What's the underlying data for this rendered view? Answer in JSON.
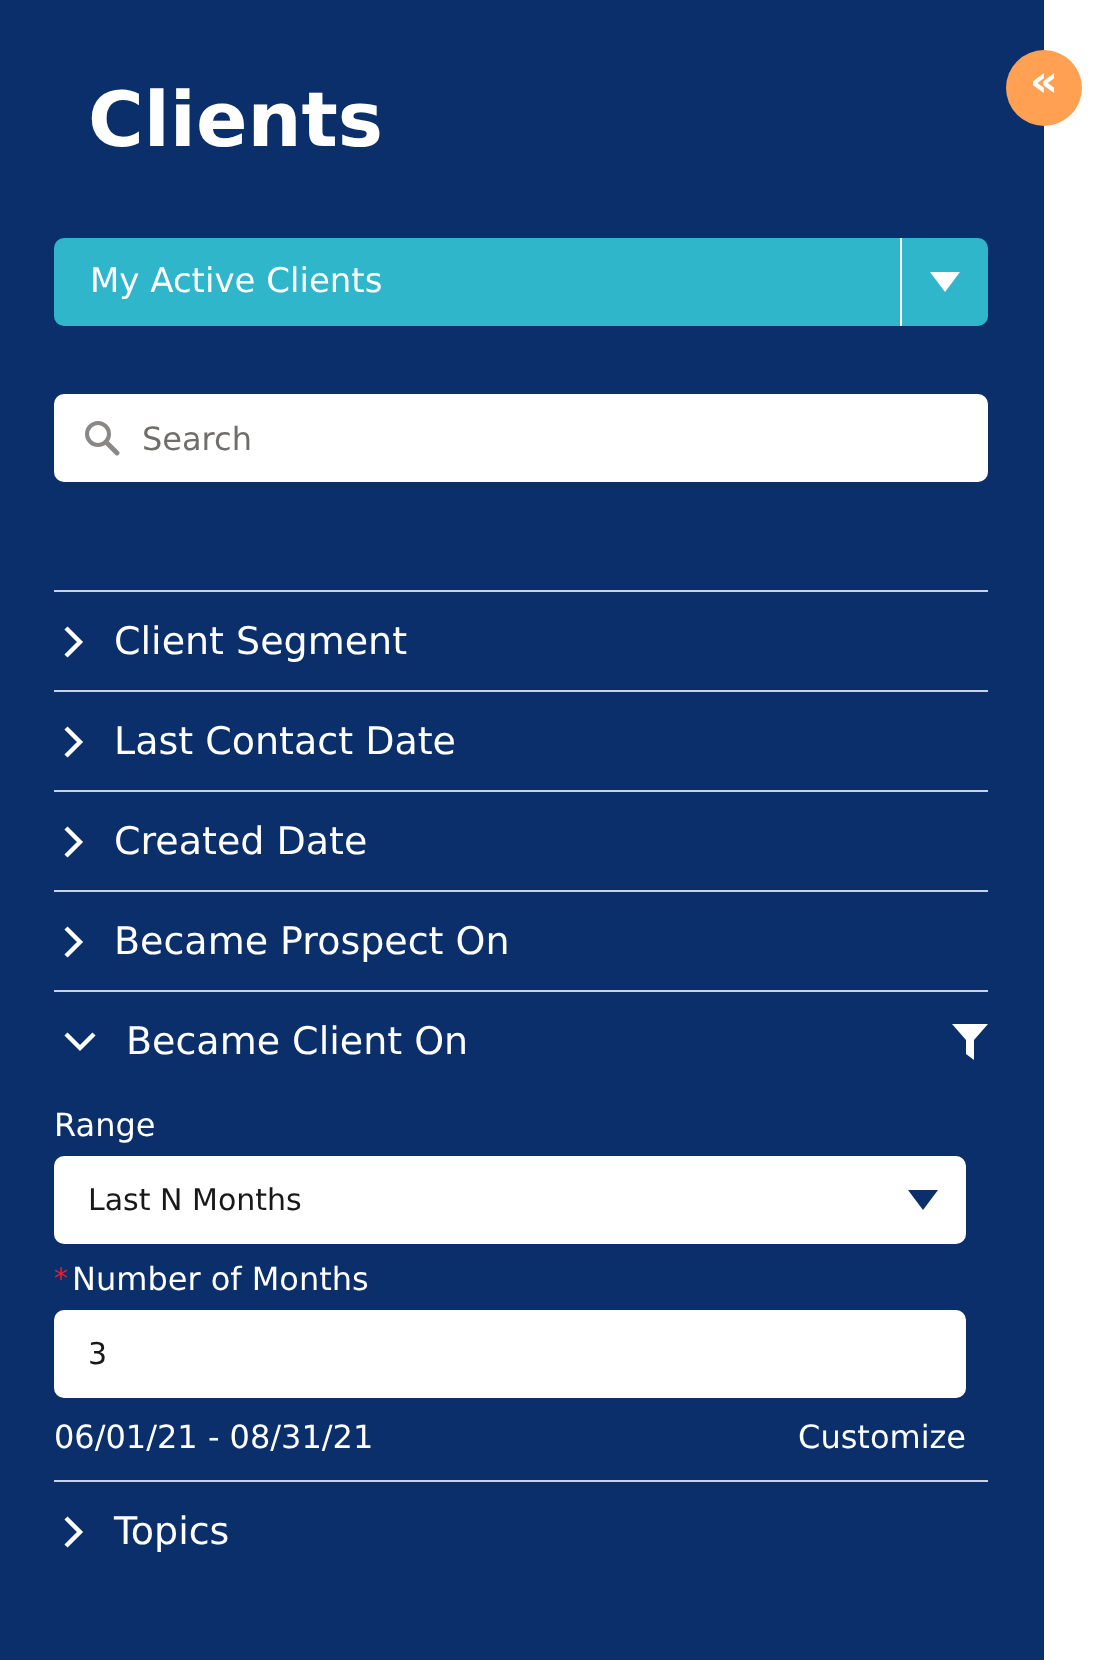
{
  "panel": {
    "title": "Clients",
    "collapse_button": {
      "label": "«"
    }
  },
  "list_view": {
    "value": "My Active Clients"
  },
  "search": {
    "placeholder": "Search"
  },
  "sections": [
    {
      "label": "Client Segment",
      "expanded": false,
      "filtered": false
    },
    {
      "label": "Last Contact Date",
      "expanded": false,
      "filtered": false
    },
    {
      "label": "Created Date",
      "expanded": false,
      "filtered": false
    },
    {
      "label": "Became Prospect On",
      "expanded": false,
      "filtered": false
    },
    {
      "label": "Became Client On",
      "expanded": true,
      "filtered": true,
      "fields": [
        {
          "kind": "select",
          "label": "Range",
          "value": "Last N Months"
        },
        {
          "kind": "input",
          "label": "Number of Months",
          "required_mark": "*",
          "value": "3"
        }
      ],
      "date_range": "06/01/21 - 08/31/21",
      "customize_link": "Customize"
    },
    {
      "label": "Topics",
      "expanded": false,
      "filtered": false
    }
  ]
}
